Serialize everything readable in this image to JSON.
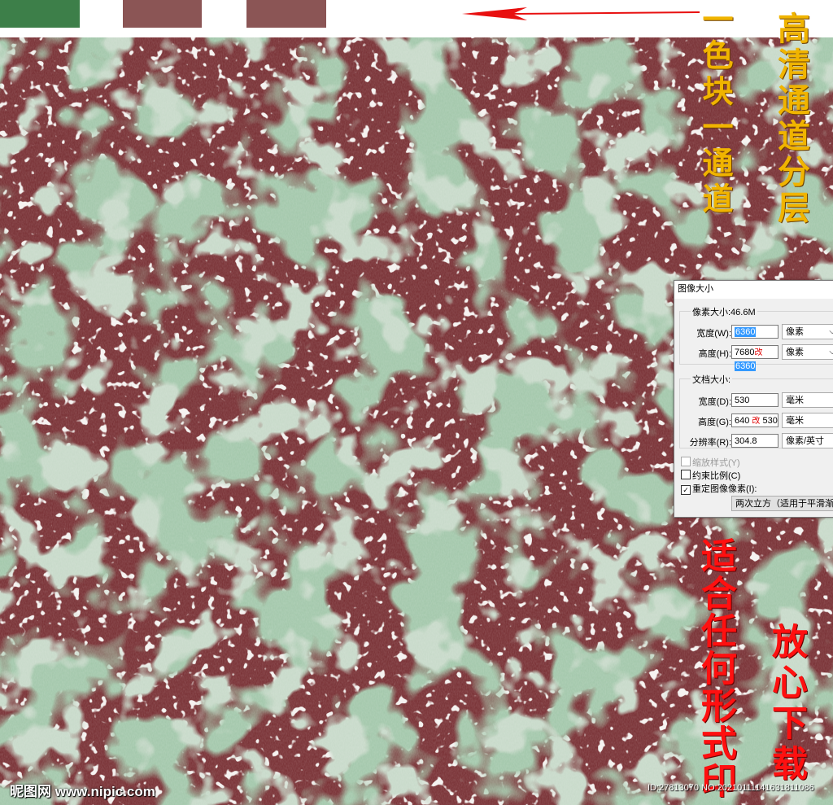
{
  "colors": {
    "green_swatch": "#3d7f49",
    "maroon_swatch_1": "#8b5555",
    "maroon_swatch_2": "#8b5555",
    "arrow": "#e81010",
    "texture_maroon": "#7a3337",
    "texture_green": "#5f9469",
    "texture_light_green": "#93b295",
    "texture_white": "#e9e3df"
  },
  "captions": {
    "orange_left": "一色块一通道",
    "orange_right": "高清通道分层",
    "red_left": "适合任何形式印",
    "red_right": "放心下载"
  },
  "dialog": {
    "title": "图像大小",
    "pixel_dimensions_label": "像素大小:46.6M",
    "width_label": "宽度(W):",
    "width_value": "6360",
    "width_unit": "像素",
    "height_label": "高度(H):",
    "height_old": "7680",
    "height_mark": "改",
    "height_value": "6360",
    "height_unit": "像素",
    "doc_size_label": "文档大小:",
    "doc_width_label": "宽度(D):",
    "doc_width_value": "530",
    "doc_width_unit": "毫米",
    "doc_height_label": "高度(G):",
    "doc_height_old": "640",
    "doc_height_mark": "改",
    "doc_height_value": "530",
    "doc_height_unit": "毫米",
    "resolution_label": "分辨率(R):",
    "resolution_value": "304.8",
    "resolution_unit": "像素/英寸",
    "scale_styles_label": "缩放样式(Y)",
    "constrain_label": "约束比例(C)",
    "resample_label": "重定图像像素(I):",
    "resample_method": "两次立方（适用于平滑渐变"
  },
  "watermark": {
    "site": "昵图网 www.nipic.com",
    "id_text": "ID:27813070 NO:20210111141631811086"
  }
}
